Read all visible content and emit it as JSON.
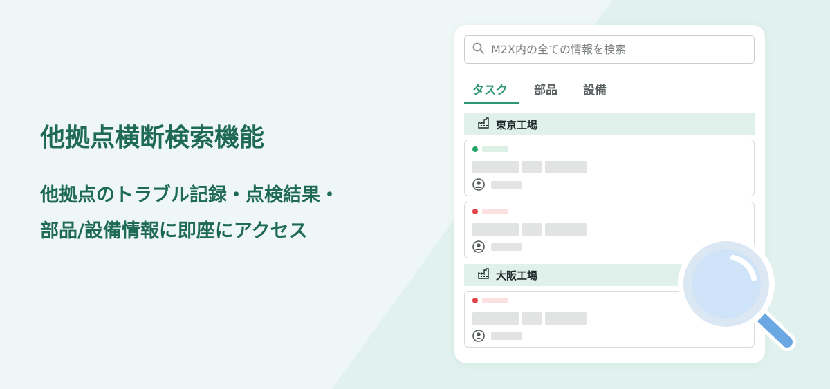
{
  "headline": "他拠点横断検索機能",
  "subtext": {
    "line1": "他拠点のトラブル記録・点検結果・",
    "line2": "部品/設備情報に即座にアクセス"
  },
  "search": {
    "placeholder": "M2X内の全ての情報を検索"
  },
  "tabs": [
    {
      "label": "タスク",
      "active": true
    },
    {
      "label": "部品",
      "active": false
    },
    {
      "label": "設備",
      "active": false
    }
  ],
  "sites": [
    {
      "name": "東京工場",
      "cards": [
        {
          "status": "green"
        },
        {
          "status": "red"
        }
      ]
    },
    {
      "name": "大阪工場",
      "cards": [
        {
          "status": "red"
        }
      ]
    }
  ],
  "icons": {
    "search": "search-icon",
    "factory": "factory-icon",
    "user": "user-avatar-icon",
    "magnifier": "magnifying-glass-icon"
  },
  "colors": {
    "brand": "#1e6a55",
    "accent": "#2e9676",
    "status_green": "#22a46a",
    "status_red": "#e0434a"
  }
}
